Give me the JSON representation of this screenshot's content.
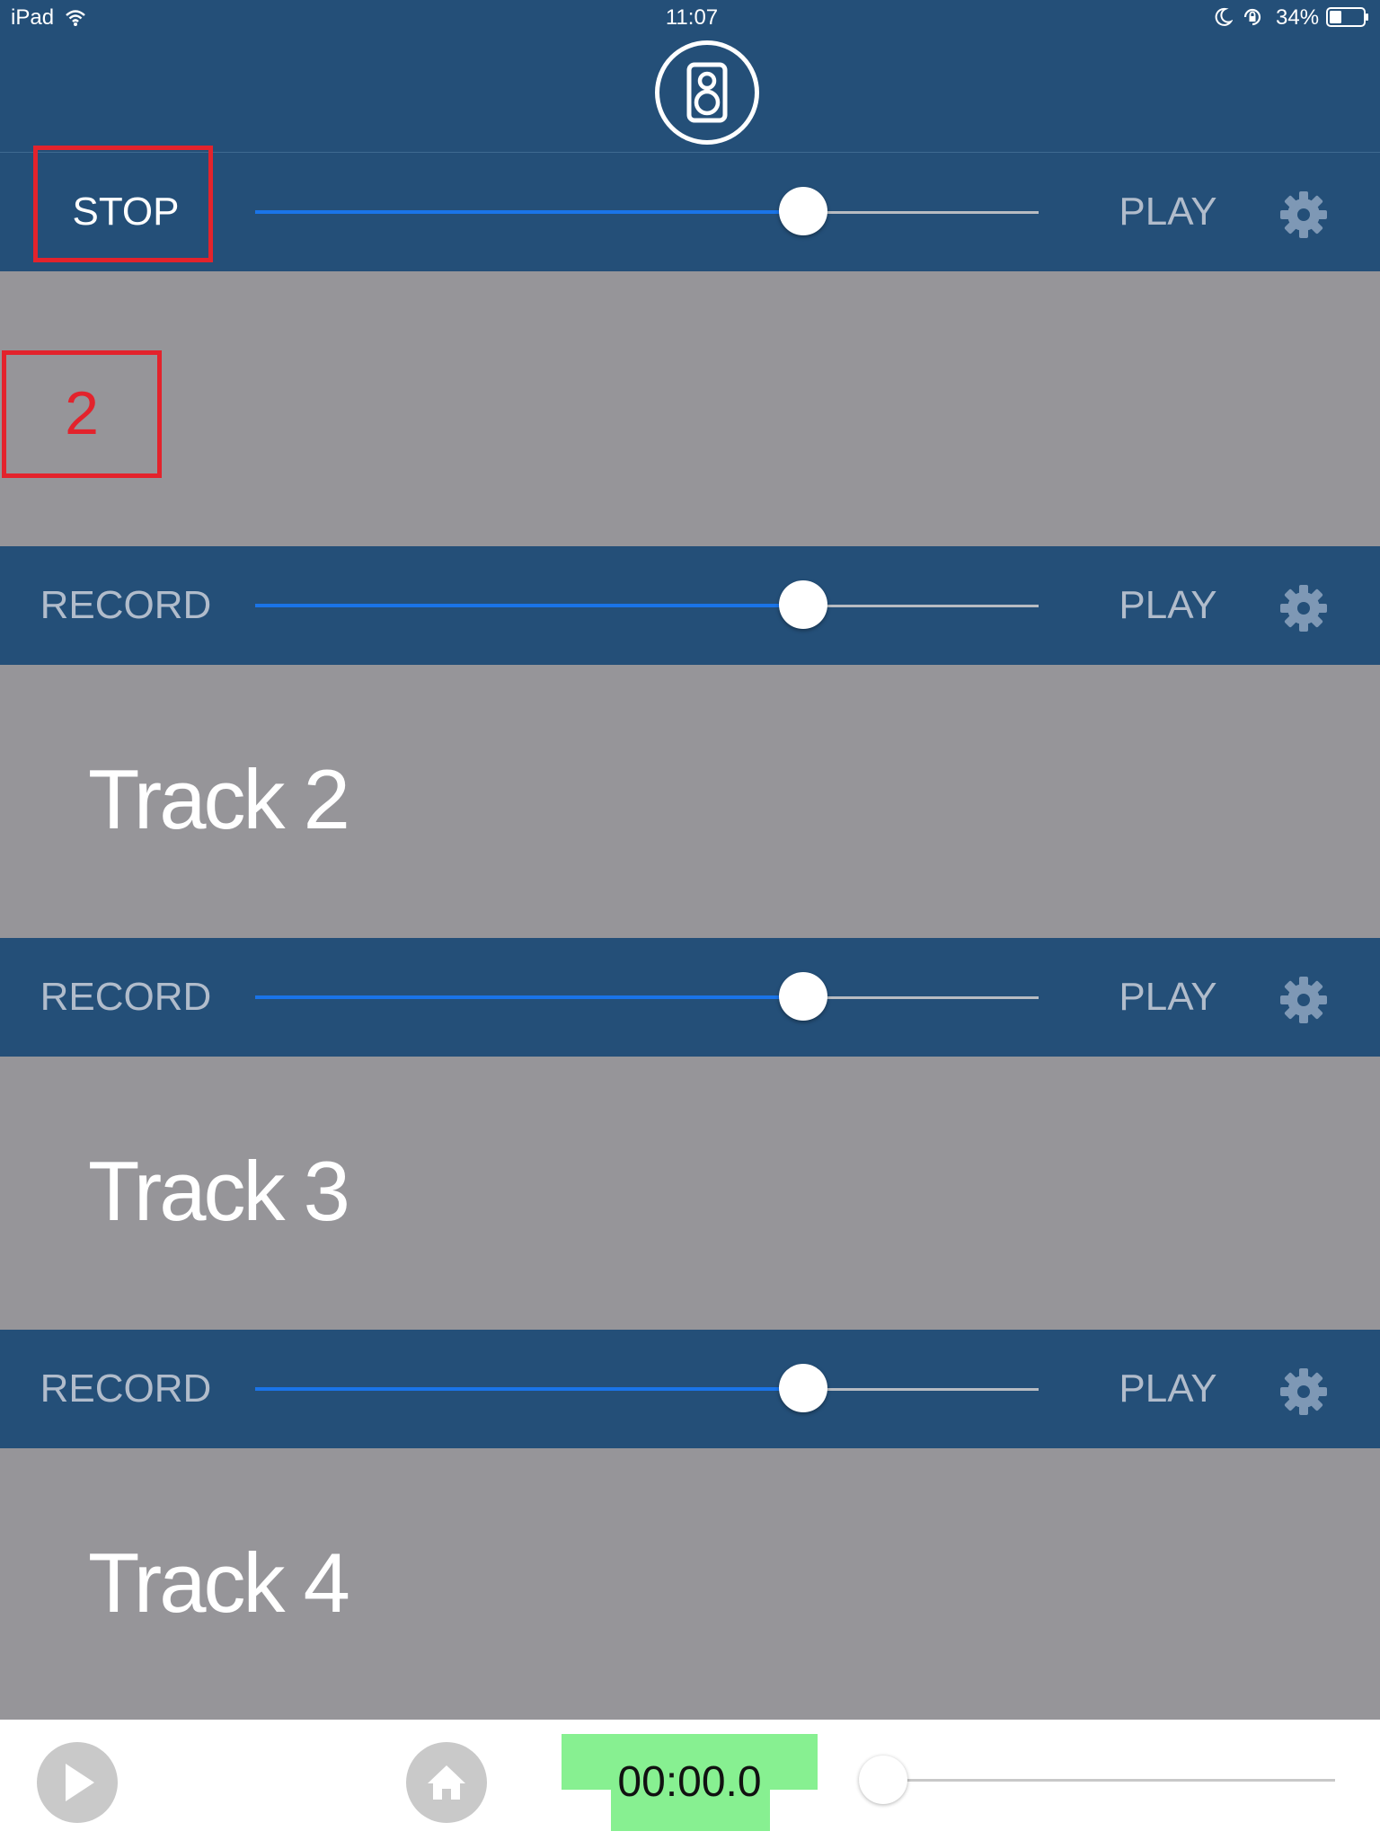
{
  "status_bar": {
    "device": "iPad",
    "time": "11:07",
    "battery": "34%"
  },
  "header": {
    "logo_icon": "speaker-icon"
  },
  "tracks": [
    {
      "record_label": "STOP",
      "play_label": "PLAY",
      "slider_value": 0.7,
      "title": ""
    },
    {
      "record_label": "RECORD",
      "play_label": "PLAY",
      "slider_value": 0.7,
      "title": "Track 2"
    },
    {
      "record_label": "RECORD",
      "play_label": "PLAY",
      "slider_value": 0.7,
      "title": "Track 3"
    },
    {
      "record_label": "RECORD",
      "play_label": "PLAY",
      "slider_value": 0.7,
      "title": "Track 4"
    }
  ],
  "annotation": {
    "number": "2"
  },
  "toolbar": {
    "timer": "00:00.0",
    "master_slider_value": 0.0
  },
  "colors": {
    "bar": "#244f78",
    "panel": "#969599",
    "slider_fill": "#1a74e8",
    "timer_bg": "#87f091",
    "annotation": "#e3232c"
  }
}
